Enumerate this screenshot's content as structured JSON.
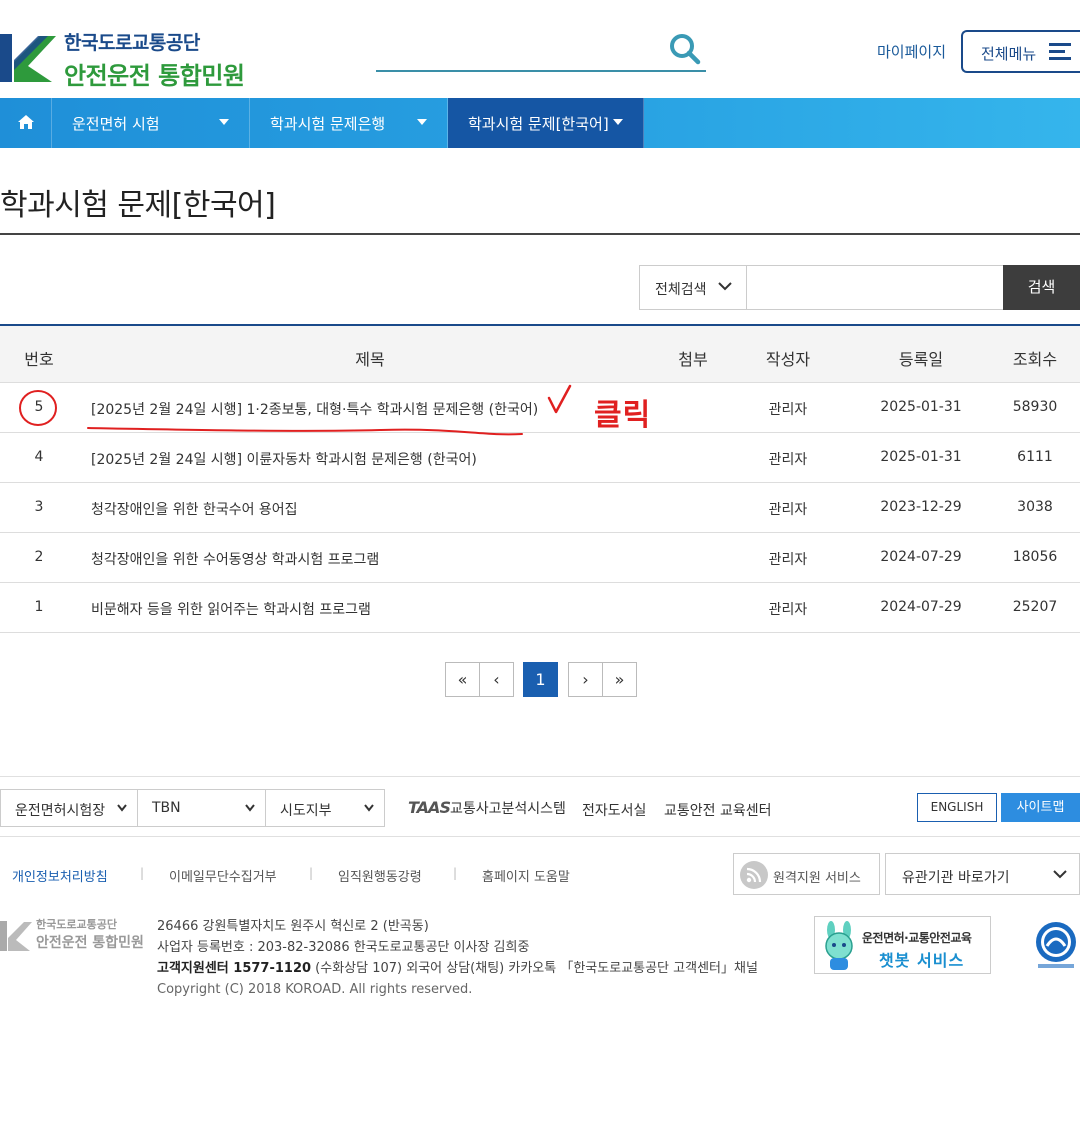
{
  "header": {
    "logo_line1": "한국도로교통공단",
    "logo_line2": "안전운전 통합민원",
    "mypage": "마이페이지",
    "menu_label": "전체메뉴"
  },
  "nav": {
    "items": [
      {
        "label": "운전면허 시험"
      },
      {
        "label": "학과시험 문제은행"
      },
      {
        "label": "학과시험 문제[한국어]"
      }
    ]
  },
  "page_title": "학과시험 문제[한국어]",
  "search": {
    "scope": "전체검색",
    "button": "검색"
  },
  "table": {
    "headers": [
      "번호",
      "제목",
      "첨부",
      "작성자",
      "등록일",
      "조회수"
    ],
    "rows": [
      {
        "no": "5",
        "title": "[2025년 2월 24일 시행] 1·2종보통, 대형·특수 학과시험 문제은행 (한국어)",
        "author": "관리자",
        "date": "2025-01-31",
        "views": "58930"
      },
      {
        "no": "4",
        "title": "[2025년 2월 24일 시행] 이륜자동차 학과시험 문제은행 (한국어)",
        "author": "관리자",
        "date": "2025-01-31",
        "views": "6111"
      },
      {
        "no": "3",
        "title": "청각장애인을 위한 한국수어 용어집",
        "author": "관리자",
        "date": "2023-12-29",
        "views": "3038"
      },
      {
        "no": "2",
        "title": "청각장애인을 위한 수어동영상 학과시험 프로그램",
        "author": "관리자",
        "date": "2024-07-29",
        "views": "18056"
      },
      {
        "no": "1",
        "title": "비문해자 등을 위한 읽어주는 학과시험 프로그램",
        "author": "관리자",
        "date": "2024-07-29",
        "views": "25207"
      }
    ]
  },
  "annotation": {
    "click_text": "클릭",
    "color": "#e02020"
  },
  "pagination": {
    "first": "«",
    "prev": "‹",
    "current": "1",
    "next": "›",
    "last": "»"
  },
  "footer": {
    "selects": [
      "운전면허시험장",
      "TBN",
      "시도지부"
    ],
    "taas_mark": "TAAS",
    "links": [
      "교통사고분석시스템",
      "전자도서실",
      "교통안전 교육센터"
    ],
    "english": "ENGLISH",
    "sitemap": "사이트맵",
    "policy_links": [
      "개인정보처리방침",
      "이메일무단수집거부",
      "임직원행동강령",
      "홈페이지 도움말"
    ],
    "remote": "원격지원 서비스",
    "related": "유관기관 바로가기",
    "logo_line1": "한국도로교통공단",
    "logo_line2": "안전운전 통합민원",
    "address": "26466 강원특별자치도 원주시 혁신로 2 (반곡동)",
    "business": "사업자 등록번호 : 203-82-32086 한국도로교통공단 이사장 김희중",
    "center_bold": "고객지원센터 1577-1120",
    "center_rest": " (수화상담 107) 외국어 상담(채팅) 카카오톡 「한국도로교통공단 고객센터」채널",
    "copyright": "Copyright (C) 2018 KOROAD. All rights reserved.",
    "chatbot_line1": "운전면허·교통안전교육",
    "chatbot_line2": "챗봇 서비스"
  },
  "colors": {
    "brand_blue": "#1a4a8a",
    "brand_green": "#2e9a3c",
    "nav_active": "#1556a4",
    "accent": "#2d8de0"
  }
}
